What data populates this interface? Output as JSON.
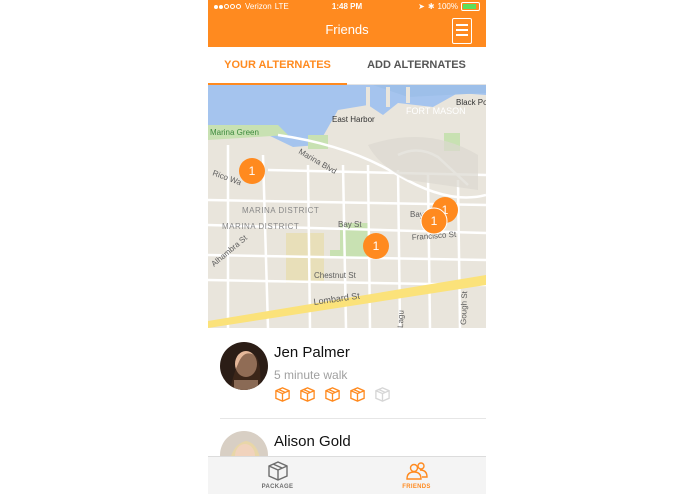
{
  "status_bar": {
    "carrier": "Verizon",
    "network": "LTE",
    "time": "1:48 PM",
    "battery": "100%"
  },
  "header": {
    "title": "Friends",
    "color": "#ff8a1f"
  },
  "tabs": [
    {
      "label": "YOUR ALTERNATES",
      "active": true
    },
    {
      "label": "ADD ALTERNATES",
      "active": false
    }
  ],
  "map": {
    "labels": {
      "fort_mason": "FORT MASON",
      "black_point": "Black Po",
      "east_harbor": "East Harbor",
      "marina_green": "Marina Green",
      "marina_blvd": "Marina Blvd",
      "marina_district_1": "MARINA DISTRICT",
      "marina_district_2": "MARINA DISTRICT",
      "rico_way": "Rico Wa",
      "bay_st_1": "Bay St",
      "bay_st_2": "Bay",
      "francisco_st": "Francisco St",
      "alhambra_st": "Alhambra St",
      "chestnut_st": "Chestnut St",
      "lombard_st": "Lombard St",
      "gough_st": "Gough St",
      "laguna": "Lagu"
    },
    "pins": [
      "1",
      "1",
      "1",
      "1"
    ]
  },
  "friends": [
    {
      "name": "Jen Palmer",
      "distance": "5 minute walk",
      "packages_filled": 4,
      "packages_total": 5
    },
    {
      "name": "Alison Gold",
      "distance": "",
      "packages_filled": 0,
      "packages_total": 0
    }
  ],
  "tab_bar": [
    {
      "label": "PACKAGE",
      "icon": "package-icon",
      "active": false
    },
    {
      "label": "FRIENDS",
      "icon": "friends-icon",
      "active": true
    }
  ]
}
